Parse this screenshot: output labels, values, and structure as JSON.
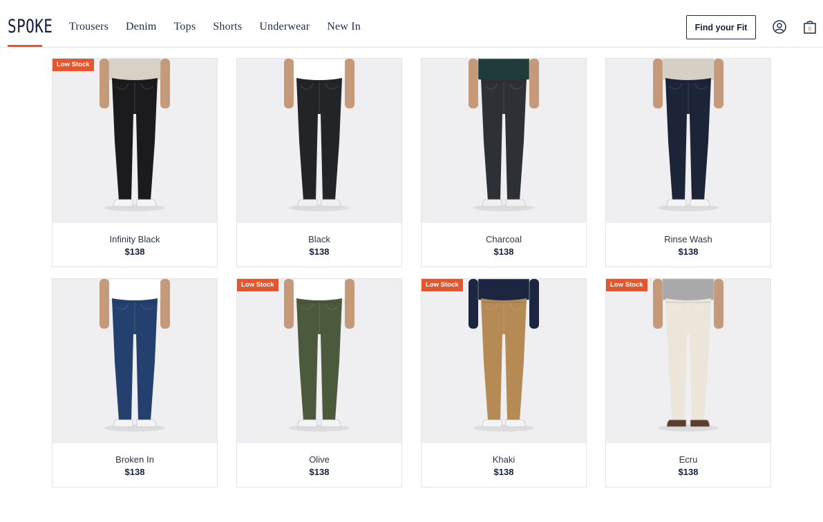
{
  "brand": {
    "logo_text": "SPOKE",
    "accent": "#e4572e",
    "navy": "#14213d"
  },
  "nav": {
    "items": [
      "Trousers",
      "Denim",
      "Tops",
      "Shorts",
      "Underwear",
      "New In"
    ]
  },
  "header": {
    "fit_button": "Find your Fit",
    "account_icon": "user-circle-icon",
    "cart_icon": "shopping-bag-icon",
    "cart_count": "0"
  },
  "products": [
    {
      "name": "Infinity Black",
      "price": "$138",
      "badge": "Low Stock",
      "pant_color": "#1b1b1d",
      "top_color": "#d8d2c6",
      "shoe_color": "#f4f4f4"
    },
    {
      "name": "Black",
      "price": "$138",
      "badge": "",
      "pant_color": "#232427",
      "top_color": "#ffffff",
      "shoe_color": "#f0f0f0"
    },
    {
      "name": "Charcoal",
      "price": "$138",
      "badge": "",
      "pant_color": "#2d3035",
      "top_color": "#1f3b3a",
      "shoe_color": "#f0f0f0"
    },
    {
      "name": "Rinse Wash",
      "price": "$138",
      "badge": "",
      "pant_color": "#1c2438",
      "top_color": "#d6d0c4",
      "shoe_color": "#f4f4f4"
    },
    {
      "name": "Broken In",
      "price": "$138",
      "badge": "",
      "pant_color": "#24406e",
      "top_color": "#ffffff",
      "shoe_color": "#f4f4f4"
    },
    {
      "name": "Olive",
      "price": "$138",
      "badge": "Low Stock",
      "pant_color": "#4a5a3a",
      "top_color": "#ffffff",
      "shoe_color": "#f4f4f4"
    },
    {
      "name": "Khaki",
      "price": "$138",
      "badge": "Low Stock",
      "pant_color": "#b58a55",
      "top_color": "#1c2640",
      "shoe_color": "#f4f4f4"
    },
    {
      "name": "Ecru",
      "price": "$138",
      "badge": "Low Stock",
      "pant_color": "#ebe6d9",
      "top_color": "#a9a9ab",
      "shoe_color": "#5b3e2e"
    }
  ]
}
